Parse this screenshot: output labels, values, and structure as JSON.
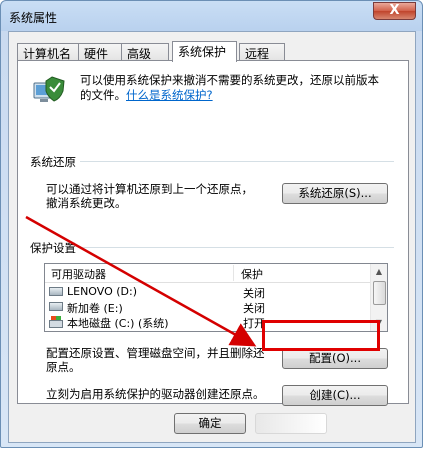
{
  "window": {
    "title": "系统属性",
    "close_label": "X"
  },
  "tabs": [
    {
      "label": "计算机名"
    },
    {
      "label": "硬件"
    },
    {
      "label": "高级"
    },
    {
      "label": "系统保护",
      "active": true
    },
    {
      "label": "远程"
    }
  ],
  "intro": {
    "text": "可以使用系统保护来撤消不需要的系统更改，还原以前版本的文件。",
    "link": "什么是系统保护?"
  },
  "restore": {
    "group_label": "系统还原",
    "description_line1": "可以通过将计算机还原到上一个还原点，",
    "description_line2": "撤消系统更改。",
    "button_label": "系统还原(S)..."
  },
  "protection": {
    "group_label": "保护设置",
    "columns": [
      "可用驱动器",
      "保护"
    ],
    "drives": [
      {
        "name": "LENOVO (D:)",
        "state": "关闭",
        "icon": "drive-icon"
      },
      {
        "name": "新加卷 (E:)",
        "state": "关闭",
        "icon": "drive-icon"
      },
      {
        "name": "本地磁盘 (C:) (系统)",
        "state": "打开",
        "icon": "system-drive-icon"
      }
    ],
    "configure_text_line1": "配置还原设置、管理磁盘空间，并且删除还",
    "configure_text_line2": "原点。",
    "configure_button": "配置(O)...",
    "create_text": "立刻为启用系统保护的驱动器创建还原点。",
    "create_button": "创建(C)..."
  },
  "footer": {
    "ok_label": "确定"
  },
  "annotation_colors": {
    "arrow": "#d40000",
    "highlight": "#e00000"
  }
}
